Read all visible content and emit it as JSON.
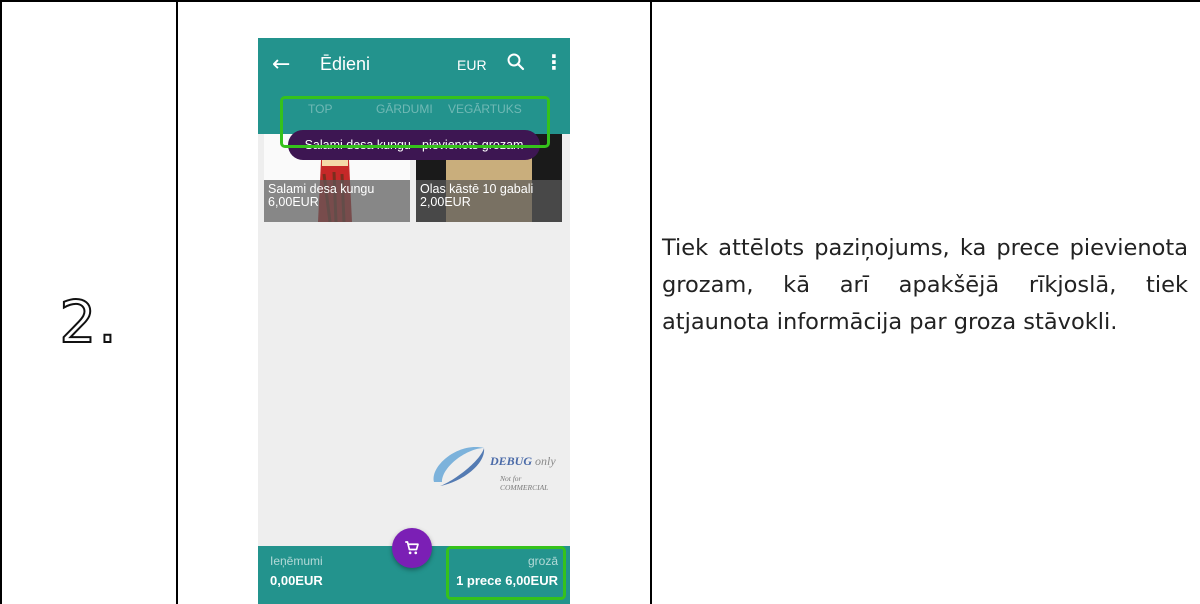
{
  "row_number": "2.",
  "description": "Tiek attēlots paziņojums, ka prece pievienota grozam, kā arī apakšējā rīkjoslā, tiek atjaunota informācija par groza stāvokli.",
  "phone": {
    "appbar": {
      "back_icon": "arrow-left-icon",
      "title": "Ēdieni",
      "currency": "EUR",
      "search_icon": "search-icon",
      "menu_icon": "more-vert-icon"
    },
    "tabs": [
      "TOP",
      "GĀRDUMI",
      "VEGĀRTUKS"
    ],
    "toast": "Salami desa kungu - pievienots grozam",
    "products": [
      {
        "name": "Salami desa kungu",
        "price": "6,00EUR"
      },
      {
        "name": "Olas kāstē 10 gabali",
        "price": "2,00EUR"
      }
    ],
    "watermark": {
      "brand": "DEBUG",
      "brand_suffix": "only",
      "sub": "Not for COMMERCIAL"
    },
    "bottom": {
      "left_label": "Ieņēmumi",
      "left_value": "0,00EUR",
      "right_label": "grozā",
      "right_value": "1 prece 6,00EUR"
    },
    "fab_icon": "cart-icon",
    "colors": {
      "primary": "#23938d",
      "toast": "#3d1652",
      "fab": "#7b1fb5",
      "highlight": "#35c21b"
    }
  }
}
